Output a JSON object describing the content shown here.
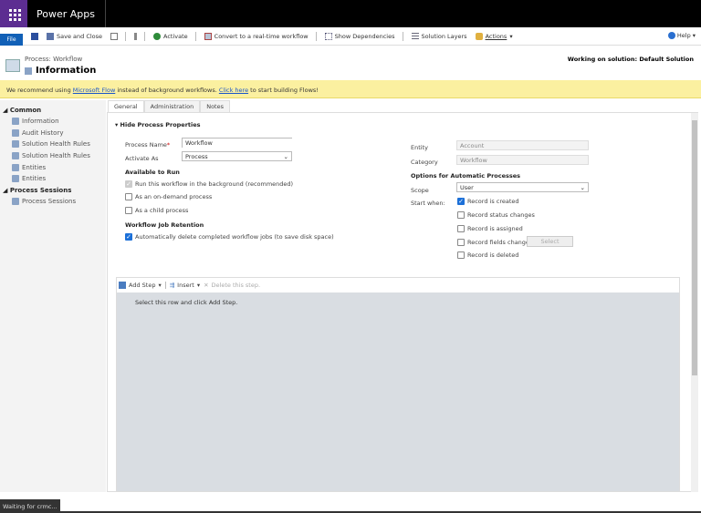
{
  "header": {
    "app_name": "Power Apps"
  },
  "toolbar": {
    "file": "File",
    "save_close": "Save and Close",
    "activate": "Activate",
    "convert": "Convert to a real-time workflow",
    "show_deps": "Show Dependencies",
    "solution_layers": "Solution Layers",
    "actions": "Actions",
    "help": "Help"
  },
  "title": {
    "breadcrumb": "Process: Workflow",
    "name": "Information",
    "solution": "Working on solution: Default Solution"
  },
  "banner": {
    "pre": "We recommend using ",
    "link1": "Microsoft Flow",
    "mid": " instead of background workflows. ",
    "link2": "Click here",
    "post": " to start building Flows!"
  },
  "nav": {
    "sections": [
      {
        "title": "Common",
        "items": [
          "Information",
          "Audit History",
          "Solution Health Rules",
          "Solution Health Rules",
          "Entities",
          "Entities"
        ]
      },
      {
        "title": "Process Sessions",
        "items": [
          "Process Sessions"
        ]
      }
    ]
  },
  "tabs": [
    "General",
    "Administration",
    "Notes"
  ],
  "form": {
    "section": "Hide Process Properties",
    "process_name_label": "Process Name",
    "required": "*",
    "process_name": "Workflow",
    "activate_as_label": "Activate As",
    "activate_as": "Process",
    "available_title": "Available to Run",
    "run_bg": "Run this workflow in the background (recommended)",
    "on_demand": "As an on-demand process",
    "child": "As a child process",
    "retention_title": "Workflow Job Retention",
    "auto_delete": "Automatically delete completed workflow jobs (to save disk space)",
    "entity_label": "Entity",
    "entity": "Account",
    "category_label": "Category",
    "category": "Workflow",
    "options_title": "Options for Automatic Processes",
    "scope_label": "Scope",
    "scope": "User",
    "start_label": "Start when:",
    "created": "Record is created",
    "status_changes": "Record status changes",
    "assigned": "Record is assigned",
    "fields_change": "Record fields change",
    "select": "Select",
    "deleted": "Record is deleted"
  },
  "steps": {
    "add": "Add Step",
    "insert": "Insert",
    "delete": "Delete this step.",
    "hint": "Select this row and click Add Step."
  },
  "status": "Waiting for crmc..."
}
